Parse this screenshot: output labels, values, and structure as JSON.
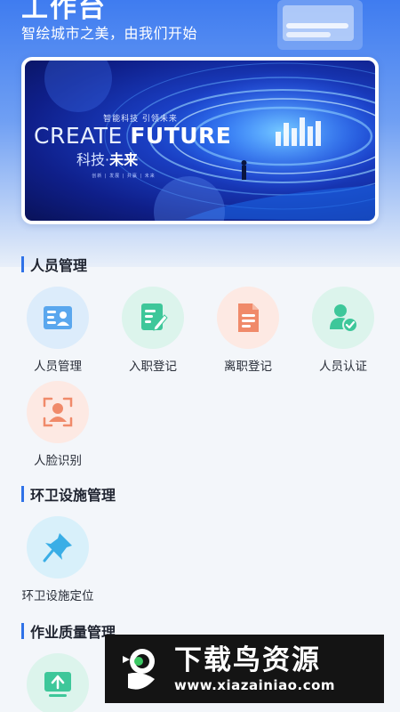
{
  "header": {
    "title": "工作台",
    "subtitle": "智绘城市之美，由我们开始"
  },
  "banner": {
    "small_text": "智能科技 引领未来",
    "main_text_thin": "CREATE ",
    "main_text_bold": "FUTURE",
    "sub_text_light": "科技·",
    "sub_text_strong": "未来",
    "tags": "创新 | 发展 | 共赢 | 未来"
  },
  "sections": [
    {
      "title": "人员管理",
      "items": [
        {
          "label": "人员管理",
          "icon": "id-card-icon",
          "color": "#5aa7ee"
        },
        {
          "label": "入职登记",
          "icon": "edit-document-icon",
          "color": "#3ec79a"
        },
        {
          "label": "离职登记",
          "icon": "document-icon",
          "color": "#f08a6a"
        },
        {
          "label": "人员认证",
          "icon": "user-verified-icon",
          "color": "#3ec79a"
        },
        {
          "label": "人脸识别",
          "icon": "face-scan-icon",
          "color": "#f08a6a"
        }
      ]
    },
    {
      "title": "环卫设施管理",
      "items": [
        {
          "label": "环卫设施定位",
          "icon": "pushpin-icon",
          "color": "#3aaee6"
        }
      ]
    },
    {
      "title": "作业质量管理",
      "items": [
        {
          "label": "",
          "icon": "upload-screen-icon",
          "color": "#3ec79a"
        }
      ]
    }
  ],
  "watermark": {
    "title": "下载鸟资源",
    "url": "www.xiazainiao.com"
  }
}
